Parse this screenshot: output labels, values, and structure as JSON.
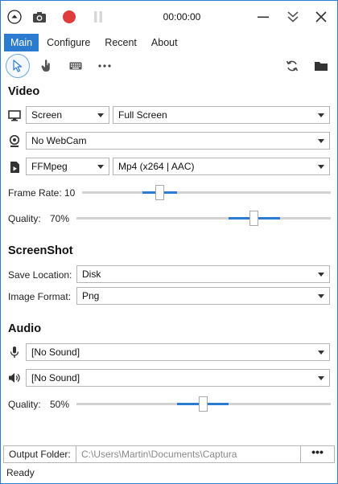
{
  "titlebar": {
    "timer": "00:00:00"
  },
  "menu": {
    "tabs": [
      "Main",
      "Configure",
      "Recent",
      "About"
    ],
    "active": "Main"
  },
  "colors": {
    "accent": "#2b7bd0",
    "record": "#e03c3c"
  },
  "video": {
    "title": "Video",
    "source": "Screen",
    "region": "Full Screen",
    "webcam": "No WebCam",
    "encoder": "FFMpeg",
    "format": "Mp4 (x264 | AAC)",
    "frame_rate_label": "Frame Rate:",
    "frame_rate_value": "10",
    "quality_label": "Quality:",
    "quality_value": "70%"
  },
  "screenshot": {
    "title": "ScreenShot",
    "save_location_label": "Save Location:",
    "save_location": "Disk",
    "image_format_label": "Image Format:",
    "image_format": "Png"
  },
  "audio": {
    "title": "Audio",
    "microphone": "[No Sound]",
    "speaker": "[No Sound]",
    "quality_label": "Quality:",
    "quality_value": "50%"
  },
  "output": {
    "label": "Output Folder:",
    "path": "C:\\Users\\Martin\\Documents\\Captura",
    "browse": "•••"
  },
  "status": "Ready",
  "icons": {
    "collapse": "chevron-up-circle-icon",
    "screenshot": "camera-icon",
    "record": "record-icon",
    "pause": "pause-icon",
    "minimize": "minimize-icon",
    "expand": "double-chevron-down-icon",
    "close": "close-icon"
  }
}
